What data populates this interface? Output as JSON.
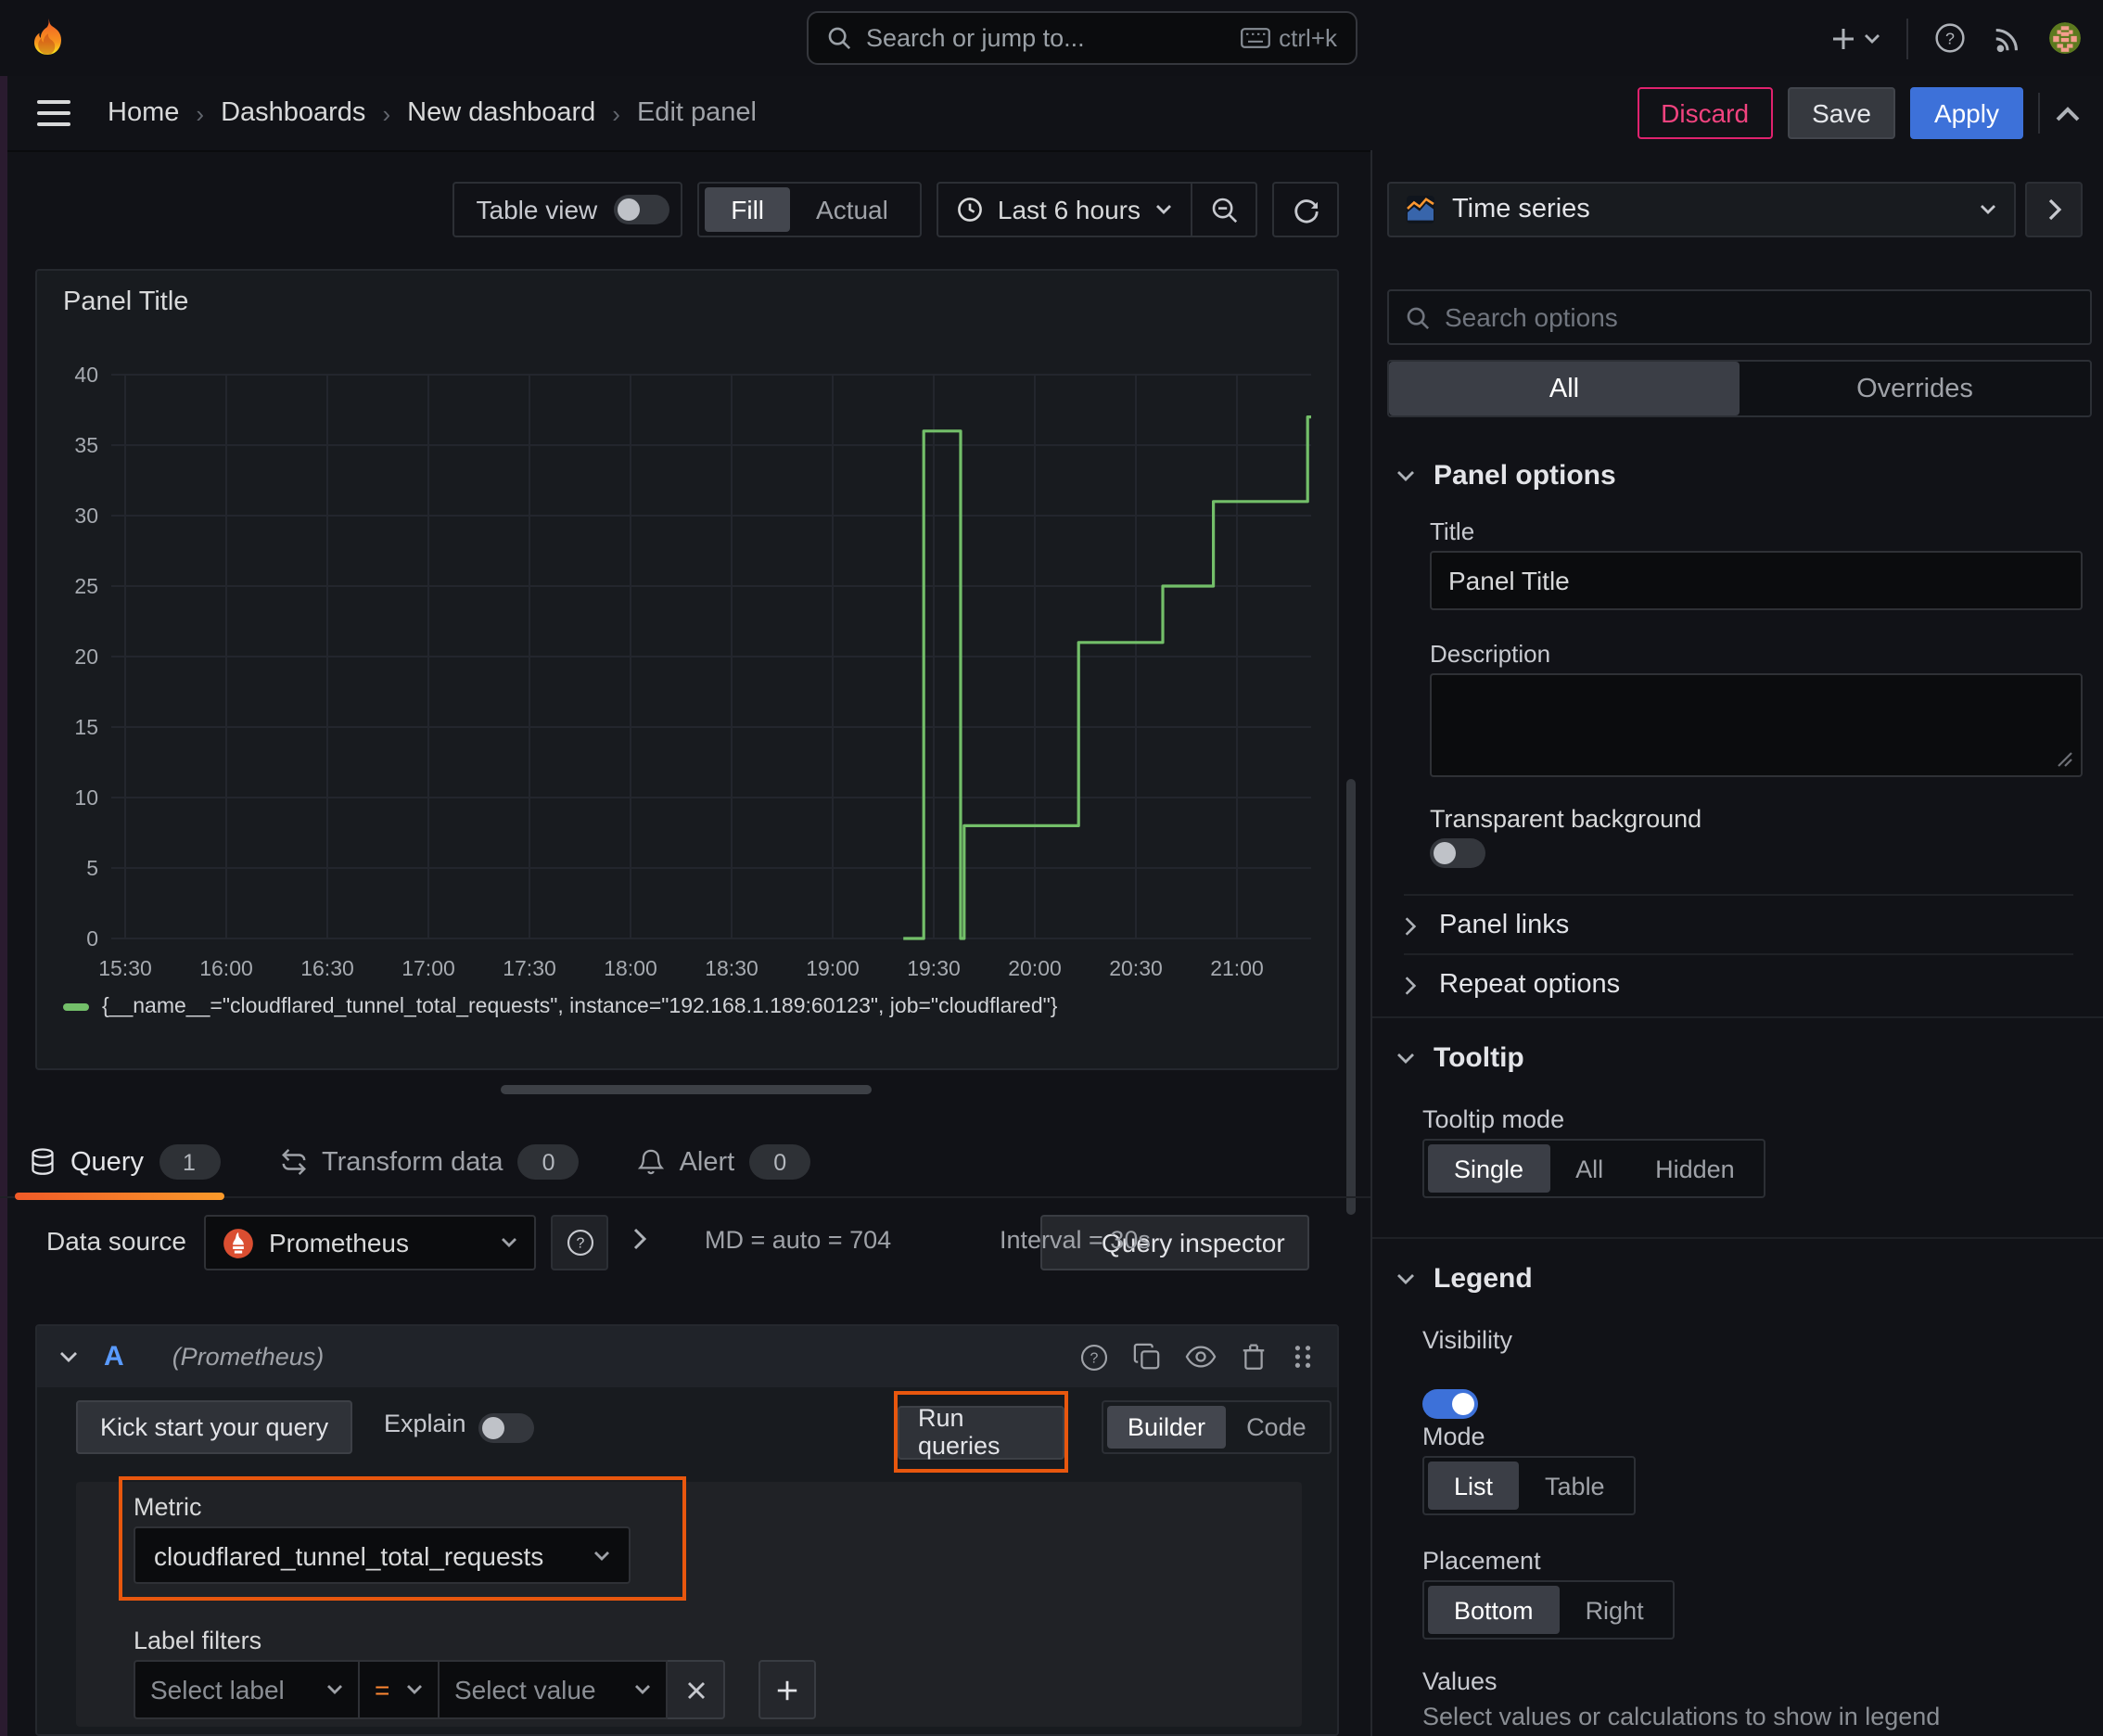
{
  "colors": {
    "accent_orange": "#e8570e",
    "series_green": "#73bf69",
    "primary_blue": "#3d71d9",
    "danger_pink": "#e0226e"
  },
  "header": {
    "search_placeholder": "Search or jump to...",
    "search_shortcut": "ctrl+k"
  },
  "breadcrumb": {
    "items": [
      "Home",
      "Dashboards",
      "New dashboard",
      "Edit panel"
    ],
    "discard_label": "Discard",
    "save_label": "Save",
    "apply_label": "Apply"
  },
  "toolbar": {
    "table_view_label": "Table view",
    "fill_label": "Fill",
    "actual_label": "Actual",
    "time_range_label": "Last 6 hours"
  },
  "panel": {
    "title": "Panel Title"
  },
  "chart_data": {
    "type": "line",
    "title": "Panel Title",
    "step": true,
    "x_ticks": [
      "15:30",
      "16:00",
      "16:30",
      "17:00",
      "17:30",
      "18:00",
      "18:30",
      "19:00",
      "19:30",
      "20:00",
      "20:30",
      "21:00"
    ],
    "y_ticks": [
      0,
      5,
      10,
      15,
      20,
      25,
      30,
      35,
      40
    ],
    "ylim": [
      0,
      40
    ],
    "grid": true,
    "legend_position": "bottom",
    "series": [
      {
        "name": "{__name__=\"cloudflared_tunnel_total_requests\", instance=\"192.168.1.189:60123\", job=\"cloudflared\"}",
        "color": "#73bf69",
        "points": [
          [
            "19:21",
            0
          ],
          [
            "19:27",
            0
          ],
          [
            "19:27",
            36
          ],
          [
            "19:38",
            36
          ],
          [
            "19:38",
            0
          ],
          [
            "19:39",
            0
          ],
          [
            "19:39",
            8
          ],
          [
            "20:13",
            8
          ],
          [
            "20:13",
            21
          ],
          [
            "20:38",
            21
          ],
          [
            "20:38",
            25
          ],
          [
            "20:53",
            25
          ],
          [
            "20:53",
            31
          ],
          [
            "21:21",
            31
          ],
          [
            "21:21",
            37
          ],
          [
            "21:22",
            37
          ]
        ]
      }
    ]
  },
  "tabs": {
    "query_label": "Query",
    "query_count": "1",
    "transform_label": "Transform data",
    "transform_count": "0",
    "alert_label": "Alert",
    "alert_count": "0"
  },
  "datasource": {
    "label": "Data source",
    "name": "Prometheus",
    "md_text": "MD = auto = 704",
    "interval_text": "Interval = 30s",
    "inspector_label": "Query inspector"
  },
  "query": {
    "ref_id": "A",
    "ds_hint": "(Prometheus)",
    "kick_start_label": "Kick start your query",
    "explain_label": "Explain",
    "run_label": "Run queries",
    "builder_label": "Builder",
    "code_label": "Code",
    "metric_label": "Metric",
    "metric_value": "cloudflared_tunnel_total_requests",
    "label_filters_label": "Label filters",
    "select_label_placeholder": "Select label",
    "operator": "=",
    "select_value_placeholder": "Select value"
  },
  "options": {
    "viz_type": "Time series",
    "search_placeholder": "Search options",
    "tab_all": "All",
    "tab_overrides": "Overrides",
    "panel_options_title": "Panel options",
    "title_label": "Title",
    "title_value": "Panel Title",
    "description_label": "Description",
    "transparent_label": "Transparent background",
    "panel_links_label": "Panel links",
    "repeat_label": "Repeat options",
    "tooltip_title": "Tooltip",
    "tooltip_mode_label": "Tooltip mode",
    "tooltip_single": "Single",
    "tooltip_all": "All",
    "tooltip_hidden": "Hidden",
    "legend_title": "Legend",
    "visibility_label": "Visibility",
    "mode_label": "Mode",
    "mode_list": "List",
    "mode_table": "Table",
    "placement_label": "Placement",
    "placement_bottom": "Bottom",
    "placement_right": "Right",
    "values_label": "Values",
    "values_help": "Select values or calculations to show in legend"
  }
}
